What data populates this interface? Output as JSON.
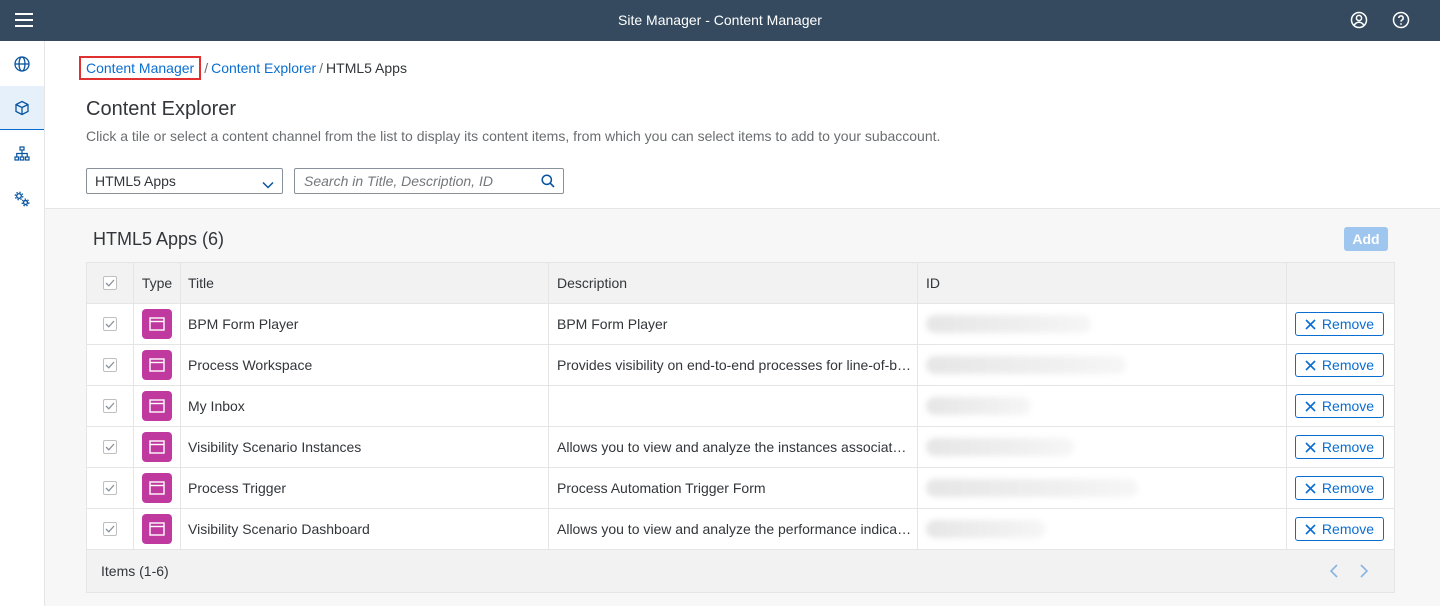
{
  "shell": {
    "title": "Site Manager - Content Manager"
  },
  "breadcrumb": {
    "items": [
      "Content Manager",
      "Content Explorer"
    ],
    "current": "HTML5 Apps",
    "separator": "/"
  },
  "header": {
    "title": "Content Explorer",
    "description": "Click a tile or select a content channel from the list to display its content items, from which you can select items to add to your subaccount."
  },
  "filters": {
    "channel_value": "HTML5 Apps",
    "search_placeholder": "Search in Title, Description, ID"
  },
  "table": {
    "title": "HTML5 Apps (6)",
    "add_label": "Add",
    "columns": {
      "type": "Type",
      "title": "Title",
      "description": "Description",
      "id": "ID"
    },
    "remove_label": "Remove",
    "rows": [
      {
        "title": "BPM Form Player",
        "description": "BPM Form Player"
      },
      {
        "title": "Process Workspace",
        "description": "Provides visibility on end-to-end processes for line-of-business users"
      },
      {
        "title": "My Inbox",
        "description": ""
      },
      {
        "title": "Visibility Scenario Instances",
        "description": "Allows you to view and analyze the instances associated with a scenario"
      },
      {
        "title": "Process Trigger",
        "description": "Process Automation Trigger Form"
      },
      {
        "title": "Visibility Scenario Dashboard",
        "description": "Allows you to view and analyze the performance indicators of a scenario"
      }
    ],
    "footer": "Items (1-6)"
  },
  "colors": {
    "shell": "#354a5f",
    "accent": "#0a6ed1",
    "type_icon": "#c0399f",
    "highlight": "#e0302f"
  }
}
